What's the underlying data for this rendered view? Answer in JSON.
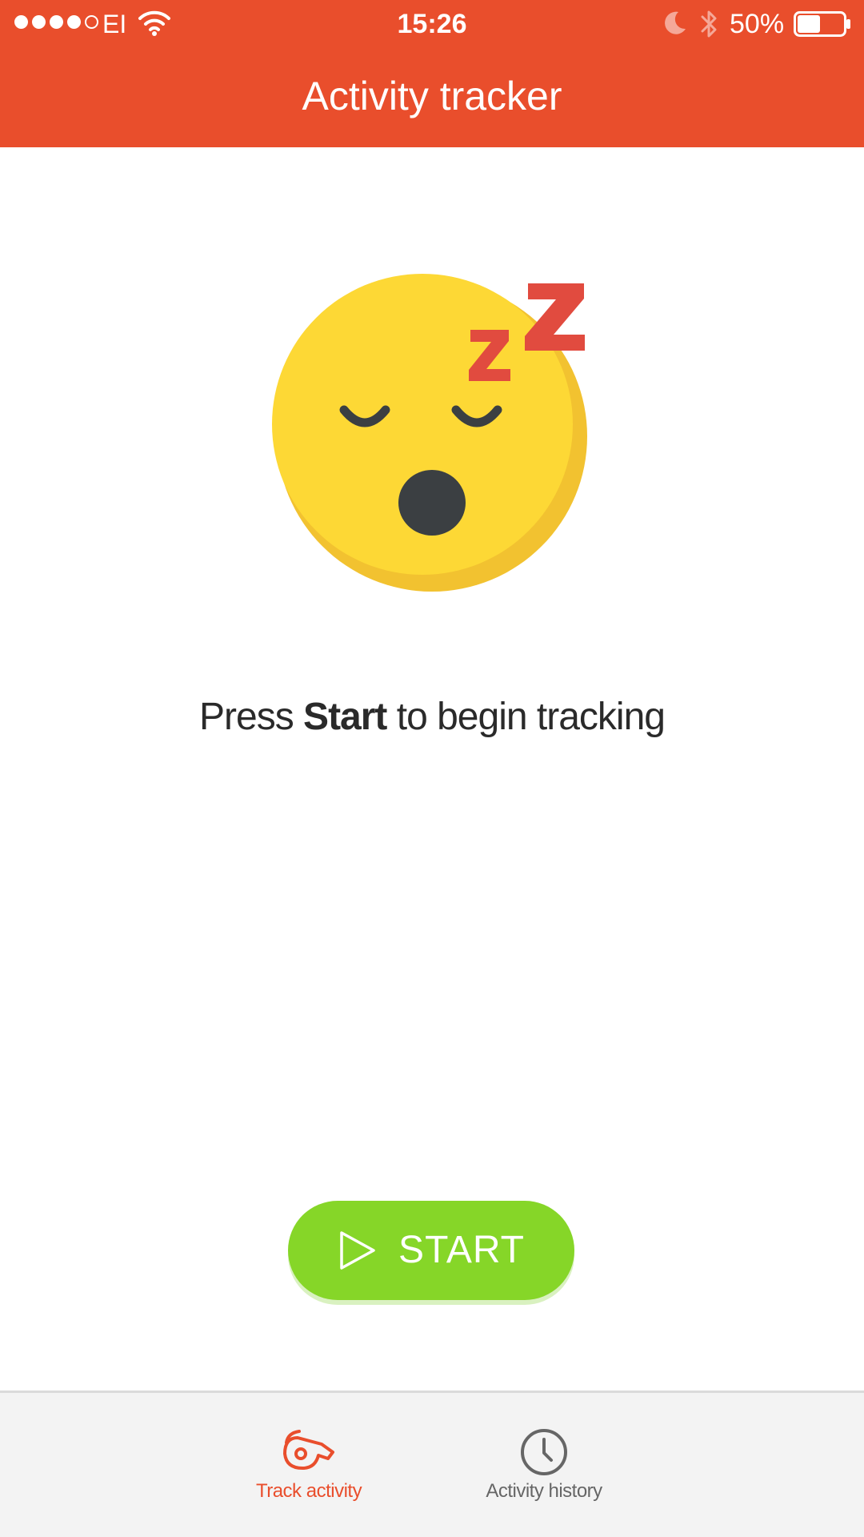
{
  "status_bar": {
    "carrier": "EI",
    "time": "15:26",
    "battery": "50%",
    "battery_level": 0.5
  },
  "header": {
    "title": "Activity tracker"
  },
  "main": {
    "message_prefix": "Press ",
    "message_bold": "Start",
    "message_suffix": " to begin tracking",
    "start_label": "START"
  },
  "tabs": [
    {
      "label": "Track activity",
      "icon": "whistle-icon",
      "active": true
    },
    {
      "label": "Activity history",
      "icon": "clock-icon",
      "active": false
    }
  ],
  "colors": {
    "brand": "#E94E2C",
    "start_button": "#86D628",
    "emoji_face": "#FDD835",
    "zzz": "#E14B3F"
  }
}
